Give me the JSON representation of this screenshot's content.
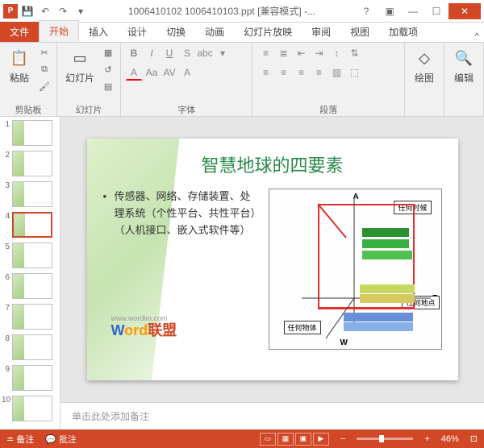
{
  "titlebar": {
    "title": "1006410102 1006410103.ppt [兼容模式] -...",
    "app_icon": "P"
  },
  "tabs": {
    "file": "文件",
    "items": [
      "开始",
      "插入",
      "设计",
      "切换",
      "动画",
      "幻灯片放映",
      "审阅",
      "视图",
      "加载项"
    ],
    "active_index": 0
  },
  "ribbon": {
    "clipboard": {
      "label": "剪贴板",
      "paste": "粘贴"
    },
    "slides": {
      "label": "幻灯片",
      "new_slide": "幻灯片"
    },
    "font": {
      "label": "字体"
    },
    "paragraph": {
      "label": "段落"
    },
    "drawing": {
      "label": "绘图",
      "btn": "绘图"
    },
    "editing": {
      "label": "编辑",
      "btn": "编辑"
    }
  },
  "thumbnails": {
    "count": 10,
    "selected": 4
  },
  "slide": {
    "title": "智慧地球的四要素",
    "bullet": "传感器、网络、存储装置、处理系统（个性平台、共性平台）（人机接口、嵌入式软件等）",
    "diagram": {
      "axis_a": "A",
      "axis_e": "E",
      "axis_w": "W",
      "lbl_anytime": "任何时候",
      "lbl_anyplace": "任何地点",
      "lbl_anything": "任何物体"
    },
    "watermark": {
      "url": "www.wordlm.com",
      "brand_w": "W",
      "brand_ord": "ord",
      "brand_suffix": "联盟"
    }
  },
  "notes": {
    "placeholder": "单击此处添加备注"
  },
  "statusbar": {
    "notes_btn": "备注",
    "comments_btn": "批注",
    "zoom": "46%"
  }
}
